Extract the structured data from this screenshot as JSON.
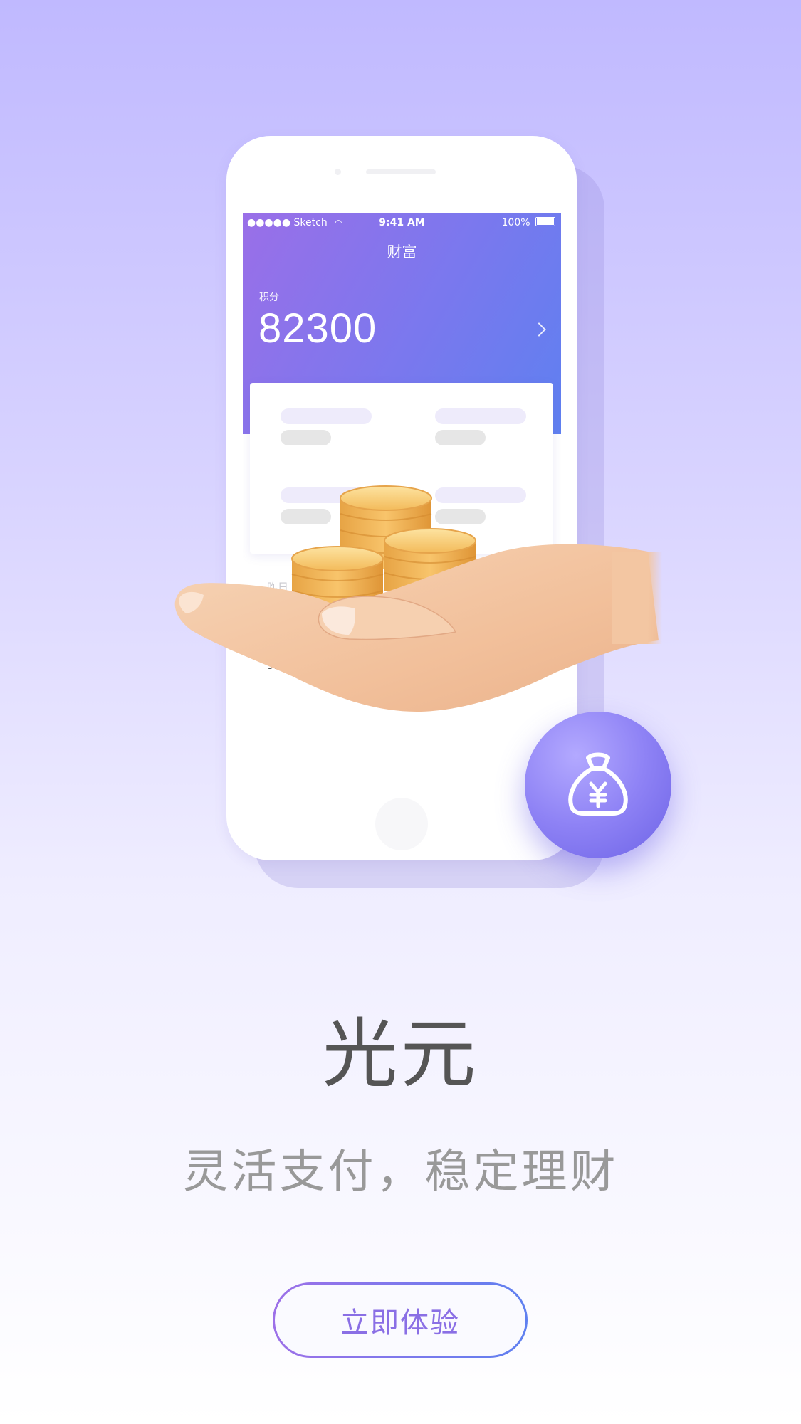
{
  "status_bar": {
    "carrier": "●●●●● Sketch",
    "time": "9:41 AM",
    "battery": "100%"
  },
  "wealth_screen": {
    "title": "财富",
    "points_label": "积分",
    "points_value": "82300",
    "yesterday_label": "昨日",
    "yesterday_value": "5."
  },
  "brand": {
    "name": "光元",
    "tagline": "灵活支付，稳定理财"
  },
  "cta": {
    "label": "立即体验"
  },
  "icons": {
    "money_bag": "money-bag-yen-icon",
    "currency_symbol": "¥"
  },
  "colors": {
    "accent_start": "#9d70e8",
    "accent_end": "#5f80f0",
    "title_text": "#555555",
    "tagline_text": "#999999",
    "cta_text": "#8a6fe5"
  }
}
